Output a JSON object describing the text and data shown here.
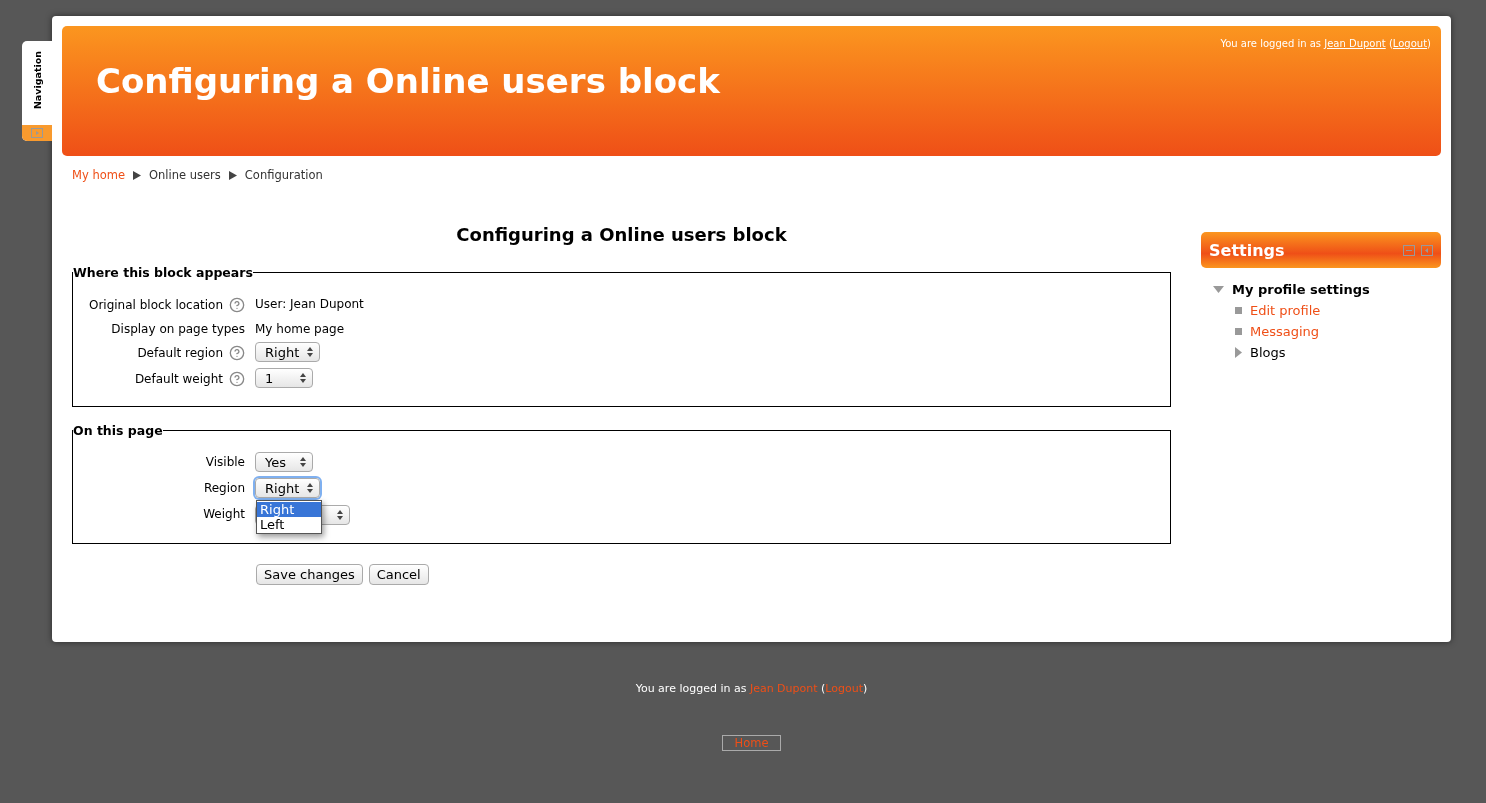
{
  "nav_tab": {
    "label": "Navigation"
  },
  "header": {
    "title": "Configuring a Online users block",
    "login": {
      "prefix": "You are logged in as ",
      "user": "Jean Dupont",
      "before_logout": " (",
      "logout": "Logout",
      "after_logout": ")"
    }
  },
  "breadcrumb": [
    {
      "label": "My home",
      "link": true
    },
    {
      "label": "Online users",
      "link": false
    },
    {
      "label": "Configuration",
      "link": false
    }
  ],
  "form": {
    "title": "Configuring a Online users block",
    "sections": [
      {
        "legend": "Where this block appears",
        "rows": [
          {
            "kind": "text",
            "label": "Original block location",
            "help": true,
            "value": "User: Jean Dupont"
          },
          {
            "kind": "text",
            "label": "Display on page types",
            "help": false,
            "value": "My home page"
          },
          {
            "kind": "select",
            "label": "Default region",
            "help": true,
            "value": "Right",
            "focused": false
          },
          {
            "kind": "select",
            "label": "Default weight",
            "help": true,
            "value": "1",
            "focused": false
          }
        ]
      },
      {
        "legend": "On this page",
        "rows": [
          {
            "kind": "select",
            "label": "Visible",
            "help": false,
            "value": "Yes",
            "focused": false
          },
          {
            "kind": "select",
            "label": "Region",
            "help": false,
            "value": "Right",
            "focused": true,
            "options": [
              {
                "label": "Right",
                "selected": true
              },
              {
                "label": "Left",
                "selected": false
              }
            ]
          },
          {
            "kind": "select",
            "label": "Weight",
            "help": false,
            "focused": false
          }
        ]
      }
    ],
    "buttons": [
      "Save changes",
      "Cancel"
    ]
  },
  "settings": {
    "title": "Settings",
    "items": [
      {
        "label": "My profile settings",
        "expanded": true,
        "children": [
          {
            "label": "Edit profile",
            "kind": "link"
          },
          {
            "label": "Messaging",
            "kind": "link"
          },
          {
            "label": "Blogs",
            "kind": "branch"
          }
        ]
      }
    ]
  },
  "footer": {
    "login": {
      "prefix": "You are logged in as ",
      "user": "Jean Dupont",
      "before_logout": " (",
      "logout": "Logout",
      "after_logout": ")"
    },
    "home": "Home"
  }
}
